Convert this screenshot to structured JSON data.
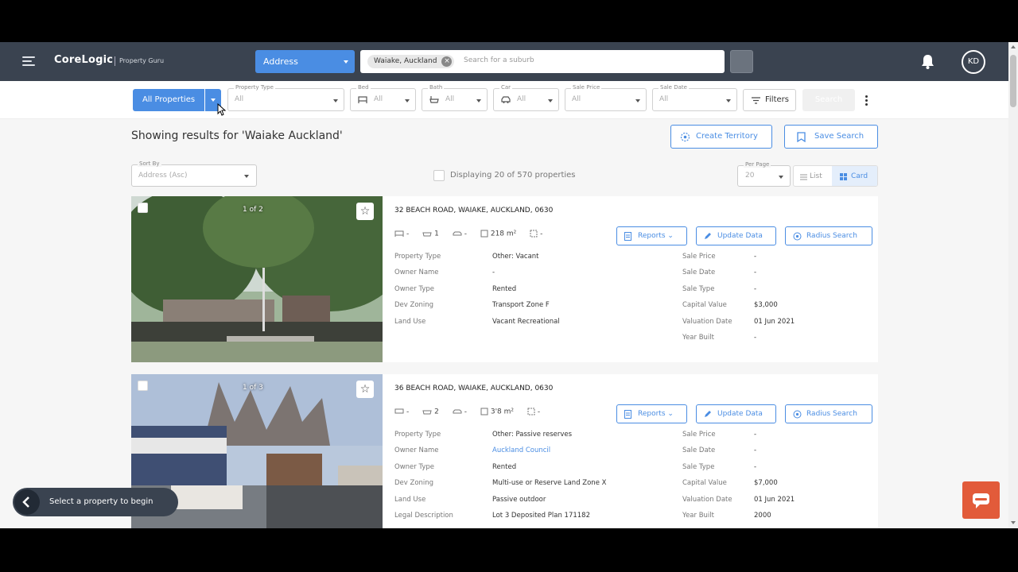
{
  "nav": {
    "brand": "CoreLogic",
    "brand_sub": "Property Guru",
    "search_mode": "Address",
    "chip": "Waiake, Auckland",
    "search_placeholder": "Search for a suburb",
    "avatar_initials": "KD"
  },
  "filters": {
    "all_properties": "All Properties",
    "fields": [
      {
        "label": "Property Type",
        "value": "All"
      },
      {
        "label": "Bed",
        "value": "All"
      },
      {
        "label": "Bath",
        "value": "All"
      },
      {
        "label": "Car",
        "value": "All"
      },
      {
        "label": "Sale Price",
        "value": "All"
      },
      {
        "label": "Sale Date",
        "value": "All"
      }
    ],
    "filters_label": "Filters",
    "search_label": "Search"
  },
  "results": {
    "heading": "Showing results for 'Waiake Auckland'",
    "create_territory": "Create Territory",
    "save_search": "Save Search",
    "sort_label": "Sort By",
    "sort_value": "Address (Asc)",
    "displaying": "Displaying 20 of 570 properties",
    "per_page_label": "Per Page",
    "per_page_value": "20",
    "view_list": "List",
    "view_card": "Card"
  },
  "card_actions": {
    "reports": "Reports",
    "update": "Update Data",
    "radius": "Radius Search"
  },
  "cards": [
    {
      "counter": "1 of 2",
      "address": "32 BEACH ROAD, WAIAKE, AUCKLAND, 0630",
      "attrs": {
        "bed": "-",
        "bath": "1",
        "car": "-",
        "land": "218 m²",
        "floor": "-"
      },
      "left": [
        {
          "k": "Property Type",
          "v": "Other: Vacant"
        },
        {
          "k": "Owner Name",
          "v": "-"
        },
        {
          "k": "Owner Type",
          "v": "Rented"
        },
        {
          "k": "Dev Zoning",
          "v": "Transport Zone F"
        },
        {
          "k": "Land Use",
          "v": "Vacant Recreational"
        }
      ],
      "right": [
        {
          "k": "Sale Price",
          "v": "-"
        },
        {
          "k": "Sale Date",
          "v": "-"
        },
        {
          "k": "Sale Type",
          "v": "-"
        },
        {
          "k": "Capital Value",
          "v": "$3,000"
        },
        {
          "k": "Valuation Date",
          "v": "01 Jun 2021"
        },
        {
          "k": "Year Built",
          "v": "-"
        }
      ]
    },
    {
      "counter": "1 of 3",
      "address": "36 BEACH ROAD, WAIAKE, AUCKLAND, 0630",
      "attrs": {
        "bed": "-",
        "bath": "2",
        "car": "-",
        "land": "3'8 m²",
        "floor": "-"
      },
      "left": [
        {
          "k": "Property Type",
          "v": "Other: Passive reserves"
        },
        {
          "k": "Owner Name",
          "v": "Auckland Council"
        },
        {
          "k": "Owner Type",
          "v": "Rented"
        },
        {
          "k": "Dev Zoning",
          "v": "Multi-use or Reserve Land Zone X"
        },
        {
          "k": "Land Use",
          "v": "Passive outdoor"
        },
        {
          "k": "Legal Description",
          "v": "Lot 3 Deposited Plan 171182"
        }
      ],
      "right": [
        {
          "k": "Sale Price",
          "v": "-"
        },
        {
          "k": "Sale Date",
          "v": "-"
        },
        {
          "k": "Sale Type",
          "v": "-"
        },
        {
          "k": "Capital Value",
          "v": "$7,000"
        },
        {
          "k": "Valuation Date",
          "v": "01 Jun 2021"
        },
        {
          "k": "Year Built",
          "v": "2000"
        }
      ]
    }
  ],
  "hint": "Select a property to begin",
  "colors": {
    "accent": "#4a8de3",
    "nav": "#3a4350",
    "chat": "#e25b3a"
  }
}
